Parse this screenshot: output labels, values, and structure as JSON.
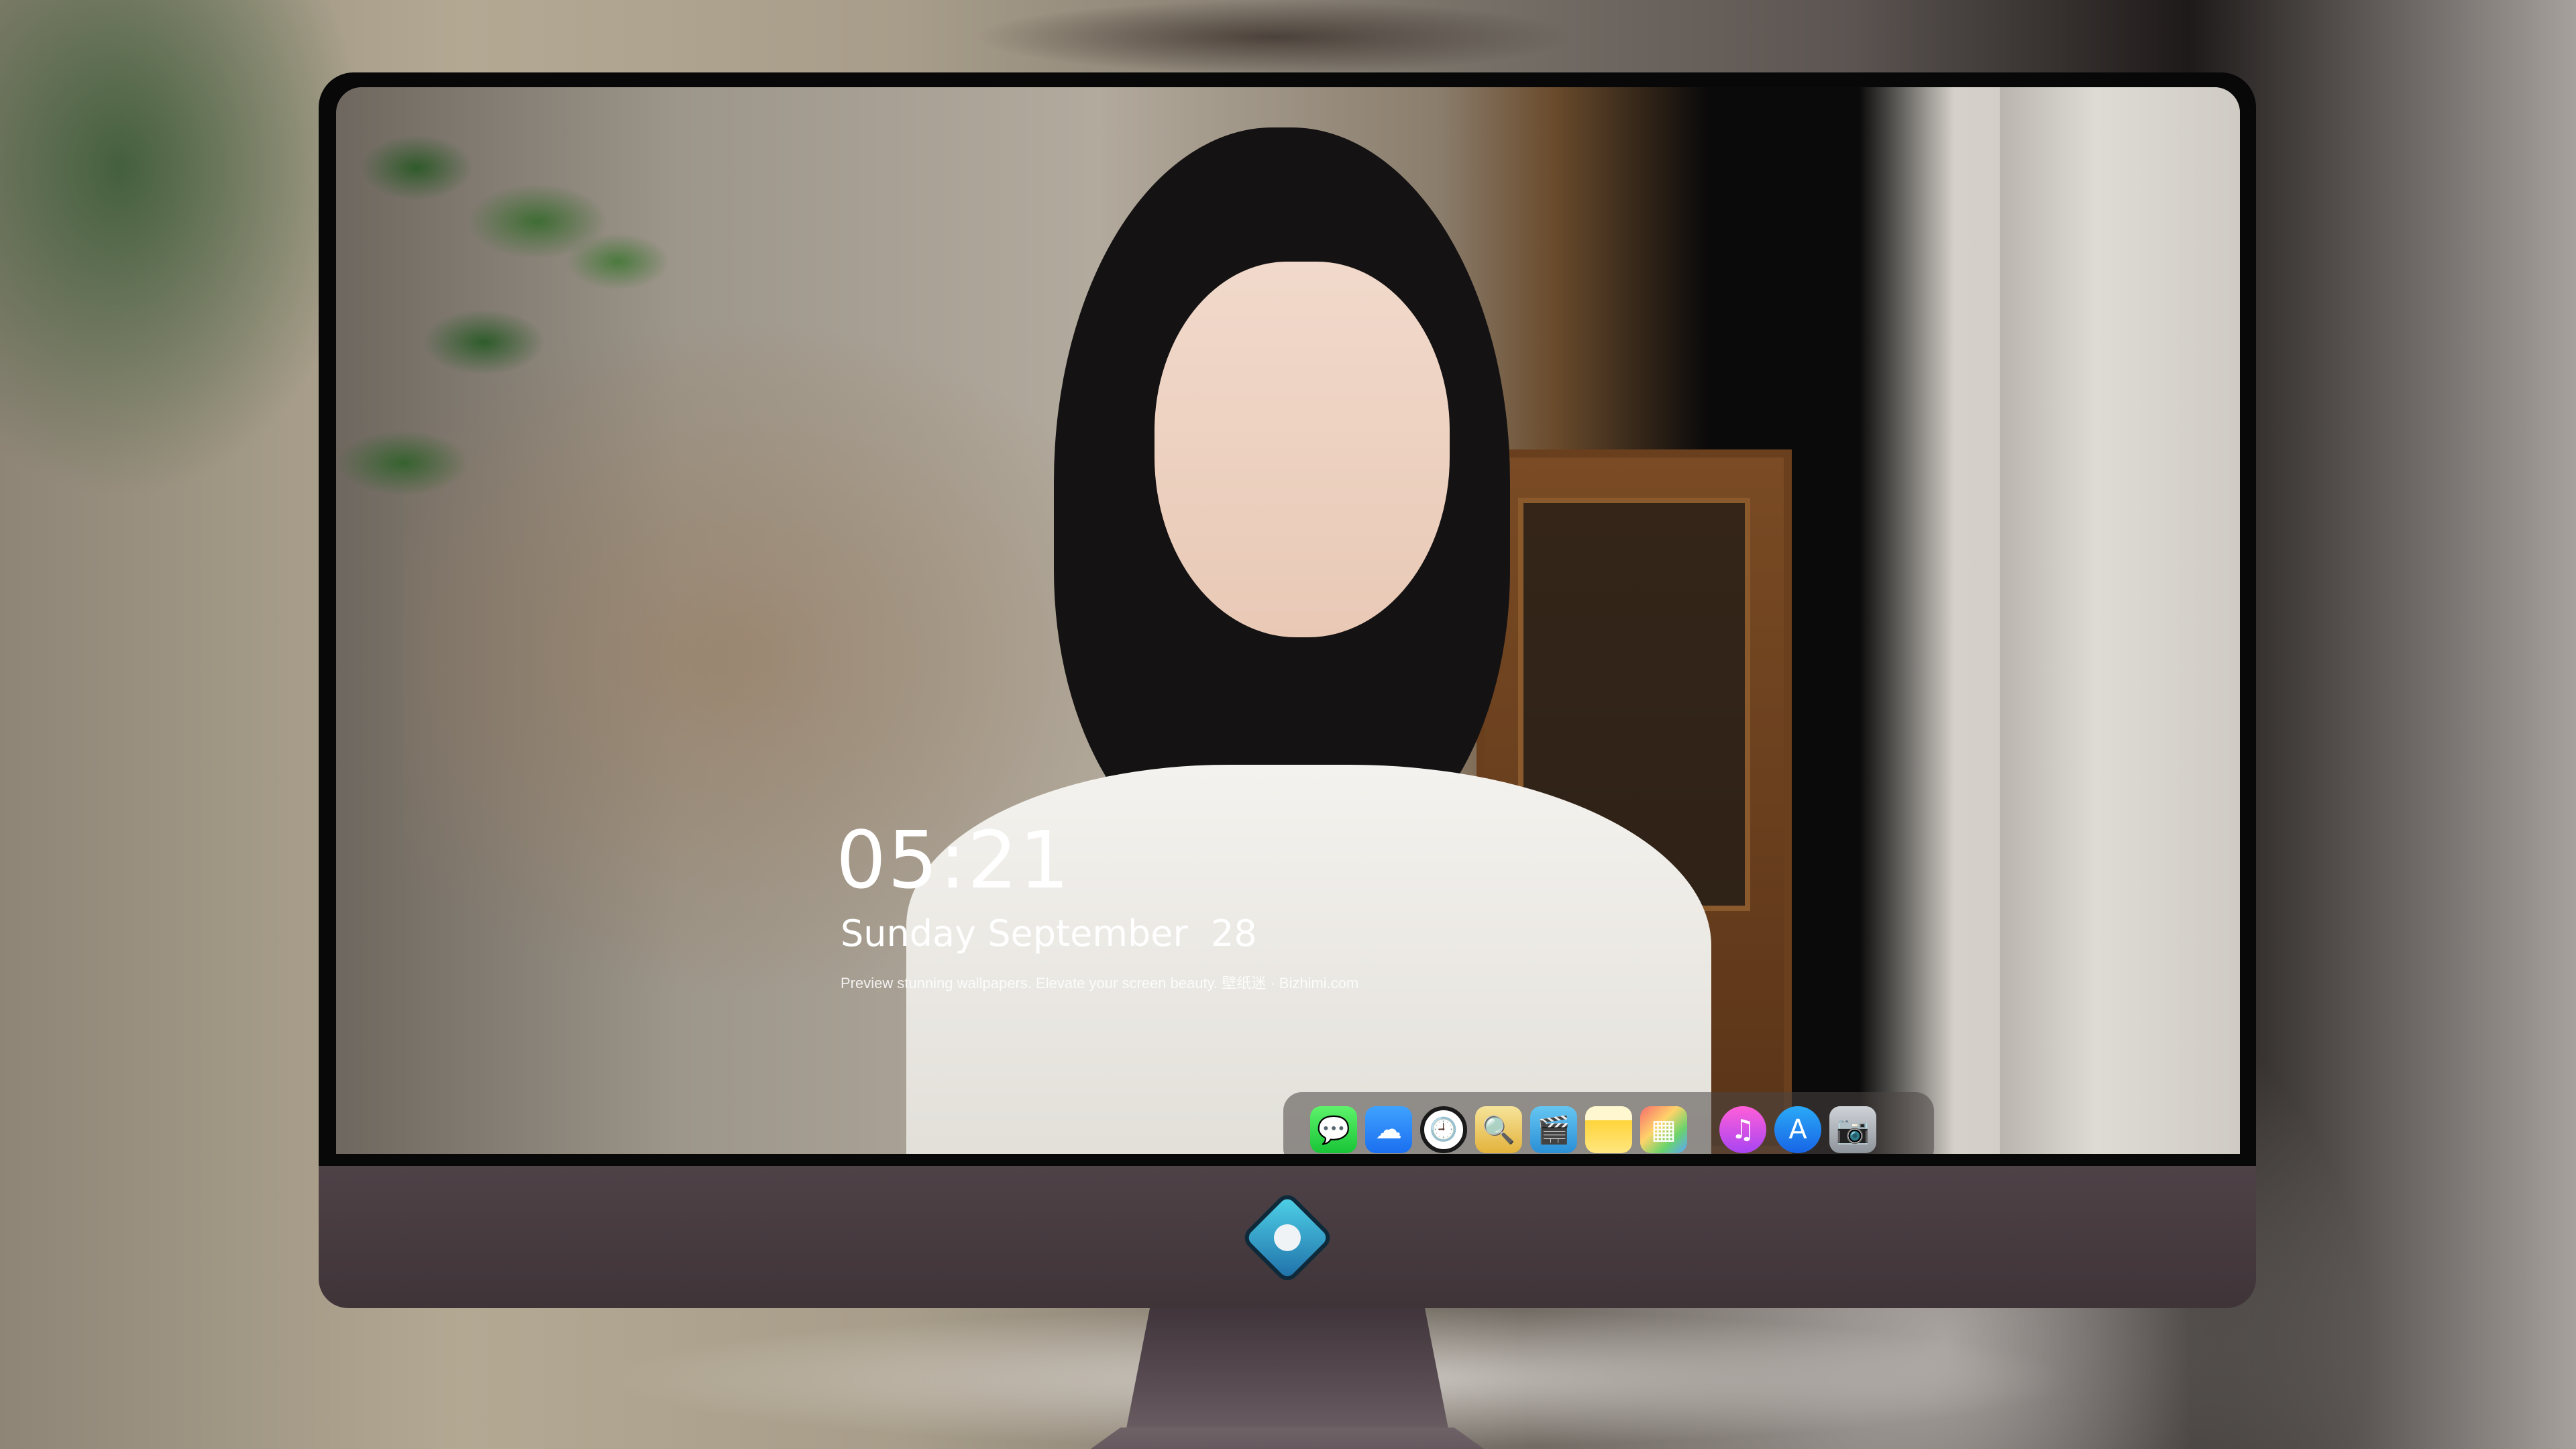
{
  "lockscreen": {
    "time": "05:21",
    "date": "Sunday September  28",
    "tagline": "Preview stunning wallpapers. Elevate your screen beauty. 壁纸迷 · Bizhimi.com"
  },
  "dock": {
    "items": [
      {
        "name": "Messages",
        "icon": "messages-icon",
        "glyph": "💬"
      },
      {
        "name": "Weather",
        "icon": "weather-icon",
        "glyph": "☁"
      },
      {
        "name": "Clock",
        "icon": "clock-icon",
        "glyph": "🕘"
      },
      {
        "name": "Preview",
        "icon": "preview-icon",
        "glyph": "🔍"
      },
      {
        "name": "Clips",
        "icon": "clapperboard-icon",
        "glyph": "🎬"
      },
      {
        "name": "Notes",
        "icon": "notes-icon",
        "glyph": ""
      },
      {
        "name": "Photos",
        "icon": "photos-icon",
        "glyph": "▦"
      },
      {
        "name": "Music",
        "icon": "music-icon",
        "glyph": "♫"
      },
      {
        "name": "App Store",
        "icon": "app-store-icon",
        "glyph": "A"
      },
      {
        "name": "Camera",
        "icon": "camera-icon",
        "glyph": "📷"
      }
    ]
  },
  "colors": {
    "chin": "#4e4247",
    "bezel": "#080808",
    "dock_background": "rgba(75,70,68,0.55)"
  }
}
